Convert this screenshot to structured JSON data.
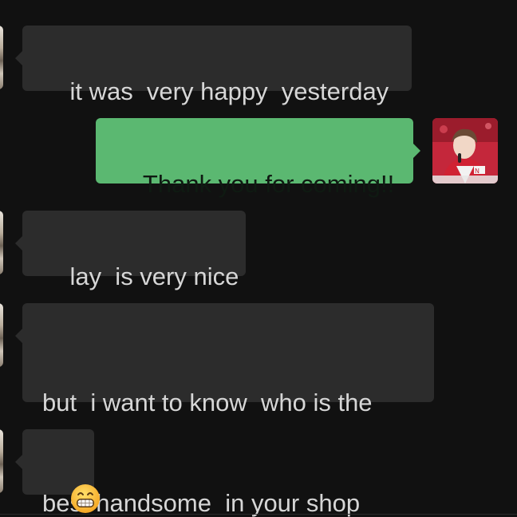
{
  "colors": {
    "background": "#111111",
    "incoming_bubble": "#2c2c2c",
    "incoming_text": "#d6d6d6",
    "outgoing_bubble": "#5bb871",
    "outgoing_text": "#0f1a12"
  },
  "messages": [
    {
      "direction": "incoming",
      "text": "it was  very happy  yesterday"
    },
    {
      "direction": "outgoing",
      "text": "Thank you for coming!!"
    },
    {
      "direction": "incoming",
      "text": "lay  is very nice"
    },
    {
      "direction": "incoming",
      "line1": "but  i want to know  who is the",
      "line2": "best handsome  in your shop"
    },
    {
      "direction": "incoming",
      "icon": "grinning-face-icon"
    }
  ]
}
